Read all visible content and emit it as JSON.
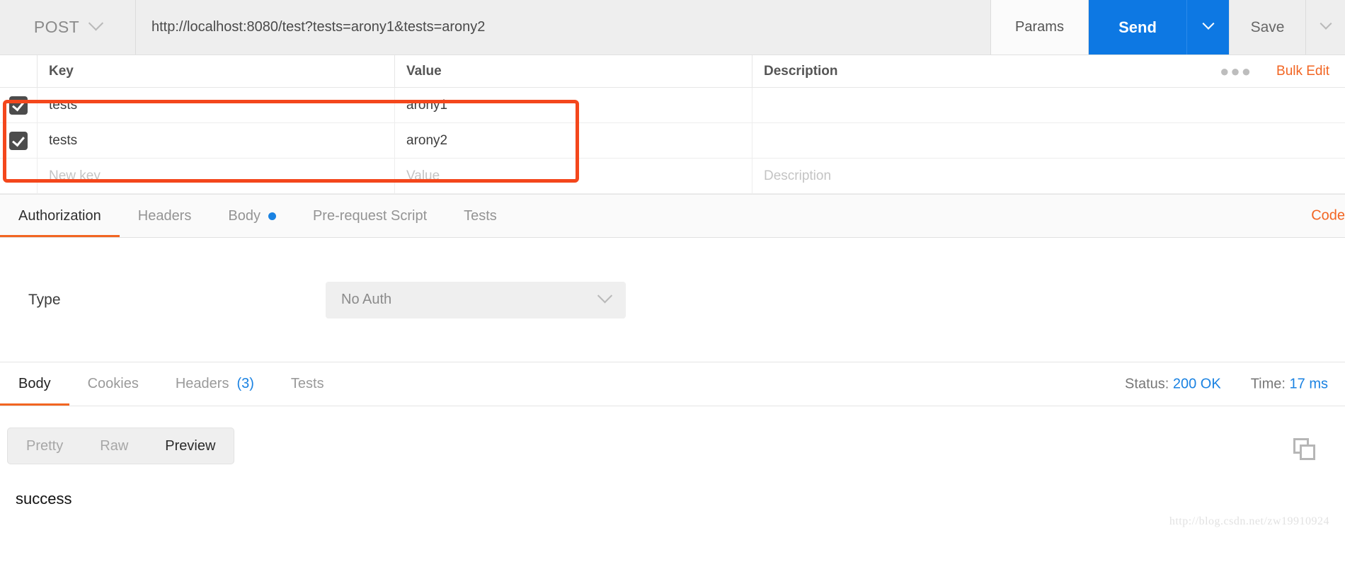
{
  "request_bar": {
    "method": "POST",
    "method_caret_icon": "chevron-down-icon",
    "url": "http://localhost:8080/test?tests=arony1&tests=arony2",
    "params_label": "Params",
    "send_label": "Send",
    "send_caret_icon": "chevron-down-icon",
    "save_label": "Save",
    "save_caret_icon": "chevron-down-icon"
  },
  "params_table": {
    "headers": {
      "key": "Key",
      "value": "Value",
      "description": "Description",
      "more_icon": "ellipsis-icon",
      "bulk_edit": "Bulk Edit"
    },
    "rows": [
      {
        "checked": true,
        "key": "tests",
        "value": "arony1",
        "description": ""
      },
      {
        "checked": true,
        "key": "tests",
        "value": "arony2",
        "description": ""
      }
    ],
    "new_row": {
      "key_placeholder": "New key",
      "value_placeholder": "Value",
      "description_placeholder": "Description"
    },
    "annotation_color": "#f4471c"
  },
  "request_tabs": {
    "items": [
      {
        "label": "Authorization",
        "active": true,
        "dot": false
      },
      {
        "label": "Headers",
        "active": false,
        "dot": false
      },
      {
        "label": "Body",
        "active": false,
        "dot": true
      },
      {
        "label": "Pre-request Script",
        "active": false,
        "dot": false
      },
      {
        "label": "Tests",
        "active": false,
        "dot": false
      }
    ],
    "code_link": "Code",
    "accent_color": "#f26522"
  },
  "auth_panel": {
    "type_label": "Type",
    "type_value": "No Auth",
    "caret_icon": "chevron-down-icon"
  },
  "response_tabs": {
    "items": [
      {
        "label": "Body",
        "active": true,
        "count": ""
      },
      {
        "label": "Cookies",
        "active": false,
        "count": ""
      },
      {
        "label": "Headers",
        "active": false,
        "count": "(3)"
      },
      {
        "label": "Tests",
        "active": false,
        "count": ""
      }
    ],
    "status_label": "Status:",
    "status_value": "200 OK",
    "time_label": "Time:",
    "time_value": "17 ms"
  },
  "response_body": {
    "view_modes": [
      {
        "label": "Pretty",
        "active": false
      },
      {
        "label": "Raw",
        "active": false
      },
      {
        "label": "Preview",
        "active": true
      }
    ],
    "copy_icon": "copy-icon",
    "content": "success",
    "watermark": "http://blog.csdn.net/zw19910924"
  }
}
